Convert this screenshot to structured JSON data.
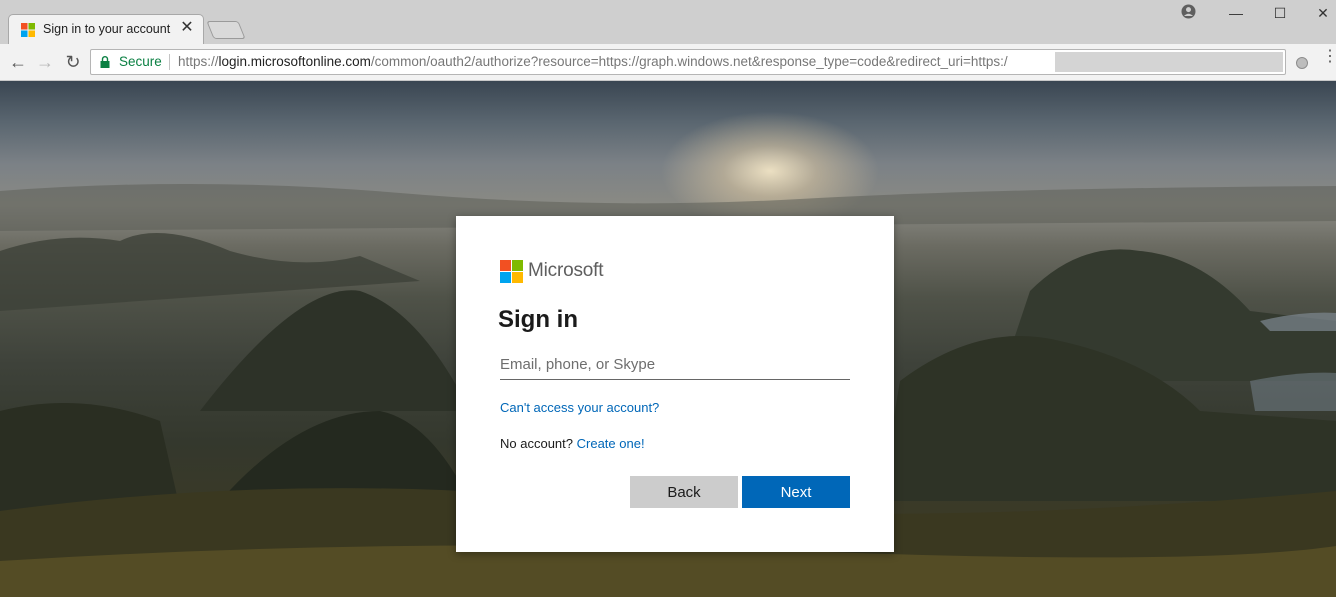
{
  "browser": {
    "tab": {
      "title": "Sign in to your account",
      "close": "✕"
    },
    "window_controls": {
      "minimize": "—",
      "maximize": "☐",
      "close": "✕"
    },
    "nav": {
      "back": "←",
      "forward": "→",
      "reload": "↻"
    },
    "omnibox": {
      "secure_label": "Secure",
      "url_scheme": "https://",
      "url_host": "login.microsoftonline.com",
      "url_path": "/common/oauth2/authorize?resource=https://graph.windows.net&response_type=code&redirect_uri=https:/"
    },
    "menu": "⋮"
  },
  "signin": {
    "brand": "Microsoft",
    "title": "Sign in",
    "email_placeholder": "Email, phone, or Skype",
    "email_value": "",
    "cant_access_link": "Can't access your account?",
    "no_account_text": "No account?",
    "create_link": "Create one!",
    "back_button": "Back",
    "next_button": "Next"
  },
  "colors": {
    "accent": "#0067b8",
    "logo_red": "#f25022",
    "logo_green": "#7fba00",
    "logo_blue": "#00a4ef",
    "logo_yellow": "#ffb900",
    "secure_green": "#0b8043"
  },
  "icons": [
    "microsoft-favicon-icon",
    "lock-icon",
    "account-icon",
    "extension-icon",
    "menu-icon"
  ]
}
